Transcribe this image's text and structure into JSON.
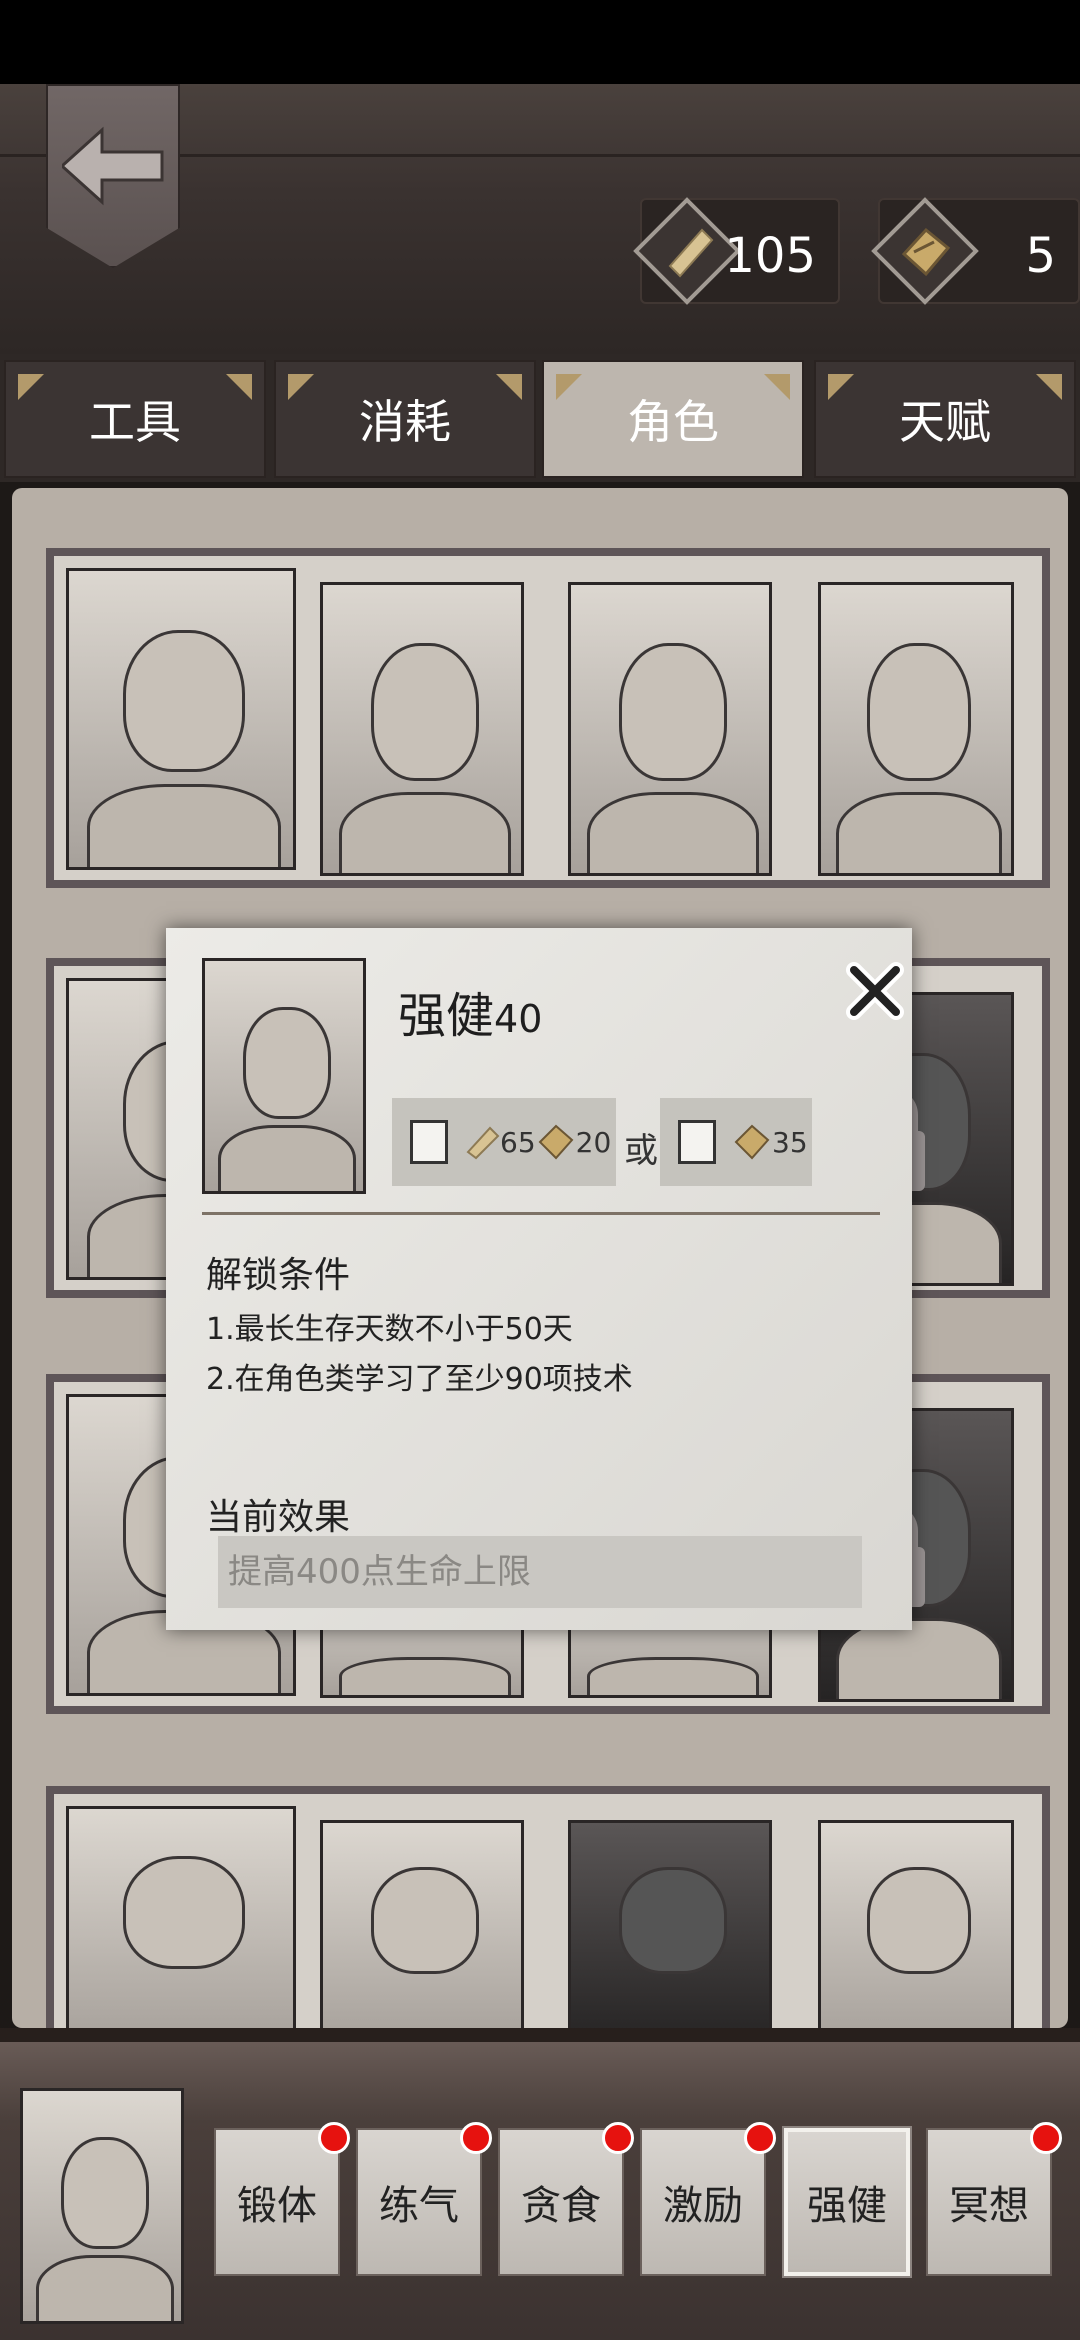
{
  "currencies": [
    {
      "icon": "scroll-icon",
      "value": "105"
    },
    {
      "icon": "book-icon",
      "value": "5"
    }
  ],
  "tabs": [
    "工具",
    "消耗",
    "角色",
    "天赋"
  ],
  "active_tab": "角色",
  "popup": {
    "title": "强健",
    "level": "40",
    "cost_a": {
      "scroll": "65",
      "book": "20"
    },
    "or_label": "或",
    "cost_b": {
      "book": "35"
    },
    "unlock_heading": "解锁条件",
    "conditions": [
      "1.最长生存天数不小于50天",
      "2.在角色类学习了至少90项技术"
    ],
    "effect_heading": "当前效果",
    "effect_text": "提高400点生命上限"
  },
  "skills": [
    "锻体",
    "练气",
    "贪食",
    "激励",
    "强健",
    "冥想"
  ],
  "selected_skill": "强健"
}
